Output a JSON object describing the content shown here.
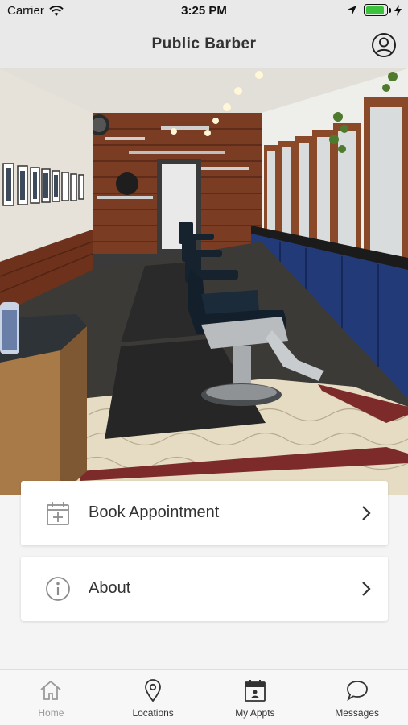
{
  "status_bar": {
    "carrier": "Carrier",
    "time": "3:25 PM",
    "battery_level": 0.9,
    "icons": [
      "wifi-icon",
      "location-arrow-icon",
      "battery-icon",
      "charging-bolt-icon"
    ]
  },
  "nav": {
    "title": "Public Barber",
    "profile_icon": "user-circle-icon"
  },
  "hero": {
    "image_description_icon": "barbershop-photo",
    "page_count": 1,
    "active_page": 1
  },
  "menu": {
    "items": [
      {
        "label": "Book Appointment",
        "icon": "calendar-add-icon"
      },
      {
        "label": "About",
        "icon": "info-circle-icon"
      }
    ]
  },
  "tabs": [
    {
      "label": "Home",
      "icon": "home-icon",
      "active": false
    },
    {
      "label": "Locations",
      "icon": "map-pin-icon",
      "active": true
    },
    {
      "label": "My Appts",
      "icon": "calendar-icon",
      "active": true
    },
    {
      "label": "Messages",
      "icon": "chat-bubble-icon",
      "active": true
    }
  ],
  "colors": {
    "bar_background": "#e9e9e9",
    "battery_green": "#3cc23c",
    "inactive_tab": "#9a9a9a"
  }
}
